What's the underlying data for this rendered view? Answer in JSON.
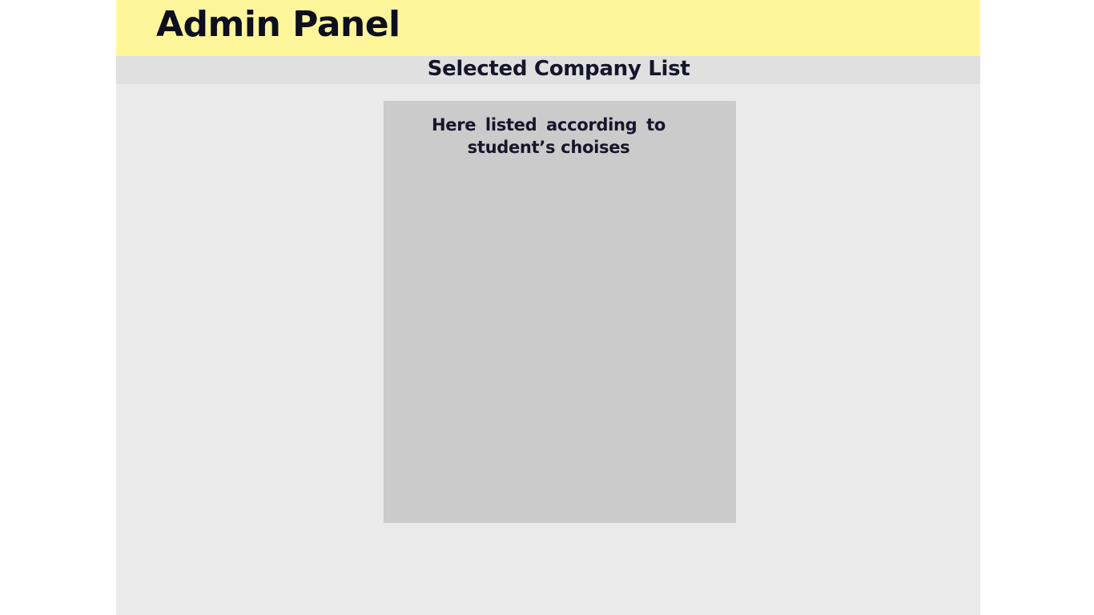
{
  "header": {
    "title": "Admin Panel"
  },
  "subheader": {
    "title": "Selected Company List"
  },
  "company_list": {
    "note": "Here listed according to student’s choises"
  },
  "colors": {
    "header_bg": "#fff69b",
    "subheader_bg": "#e0e0e0",
    "page_bg": "#eaeaea",
    "panel_bg": "#cbcbcb",
    "text": "#16152a"
  }
}
